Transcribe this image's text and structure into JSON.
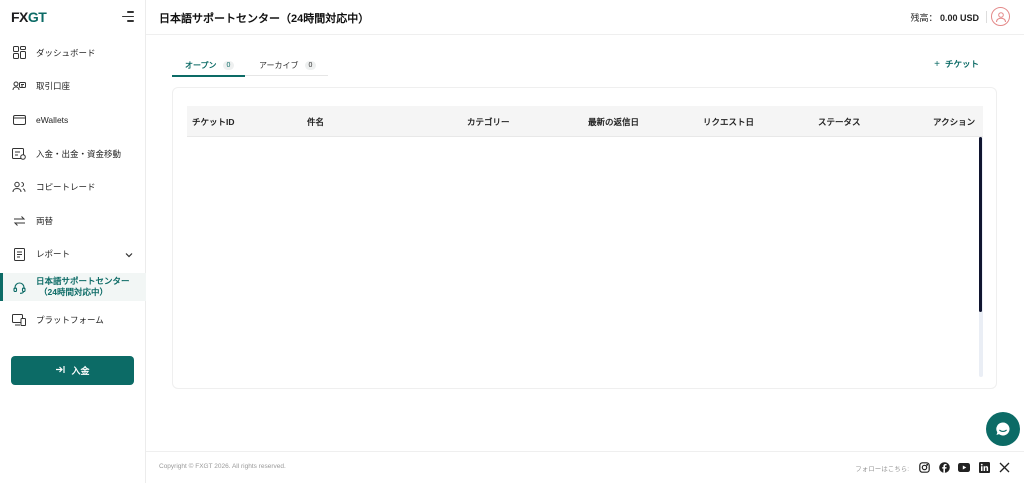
{
  "brand": {
    "logo_fx": "FX",
    "logo_gt": "GT"
  },
  "sidebar": {
    "items": [
      {
        "label": "ダッシュボード",
        "icon": "dashboard-icon"
      },
      {
        "label": "取引口座",
        "icon": "trading-account-icon"
      },
      {
        "label": "eWallets",
        "icon": "wallet-icon"
      },
      {
        "label": "入金・出金・資金移動",
        "icon": "transfer-icon"
      },
      {
        "label": "コピートレード",
        "icon": "copy-trade-icon"
      },
      {
        "label": "両替",
        "icon": "exchange-icon"
      },
      {
        "label": "レポート",
        "icon": "report-icon"
      },
      {
        "label": "日本語サポートセンター",
        "label2": "（24時間対応中）",
        "icon": "support-headset-icon"
      },
      {
        "label": "プラットフォーム",
        "icon": "platform-icon"
      }
    ],
    "deposit_button": "入金"
  },
  "header": {
    "title": "日本語サポートセンター（24時間対応中）",
    "balance_label": "残高：",
    "balance_value": "0.00 USD"
  },
  "tabs": [
    {
      "label": "オープン",
      "count": "0",
      "active": true
    },
    {
      "label": "アーカイブ",
      "count": "0",
      "active": false
    }
  ],
  "add_ticket_label": "チケット",
  "table": {
    "columns": [
      "チケットID",
      "件名",
      "カテゴリー",
      "最新の返信日",
      "リクエスト日",
      "ステータス",
      "アクション"
    ],
    "rows": []
  },
  "footer": {
    "copyright": "Copyright © FXGT 2026. All rights reserved.",
    "follow": "フォローはこちら:",
    "social": [
      "instagram-icon",
      "facebook-icon",
      "youtube-icon",
      "linkedin-icon",
      "x-icon"
    ]
  },
  "colors": {
    "accent": "#0c6b66",
    "avatar_border": "#e48a8a",
    "scroll_thumb": "#101530"
  }
}
